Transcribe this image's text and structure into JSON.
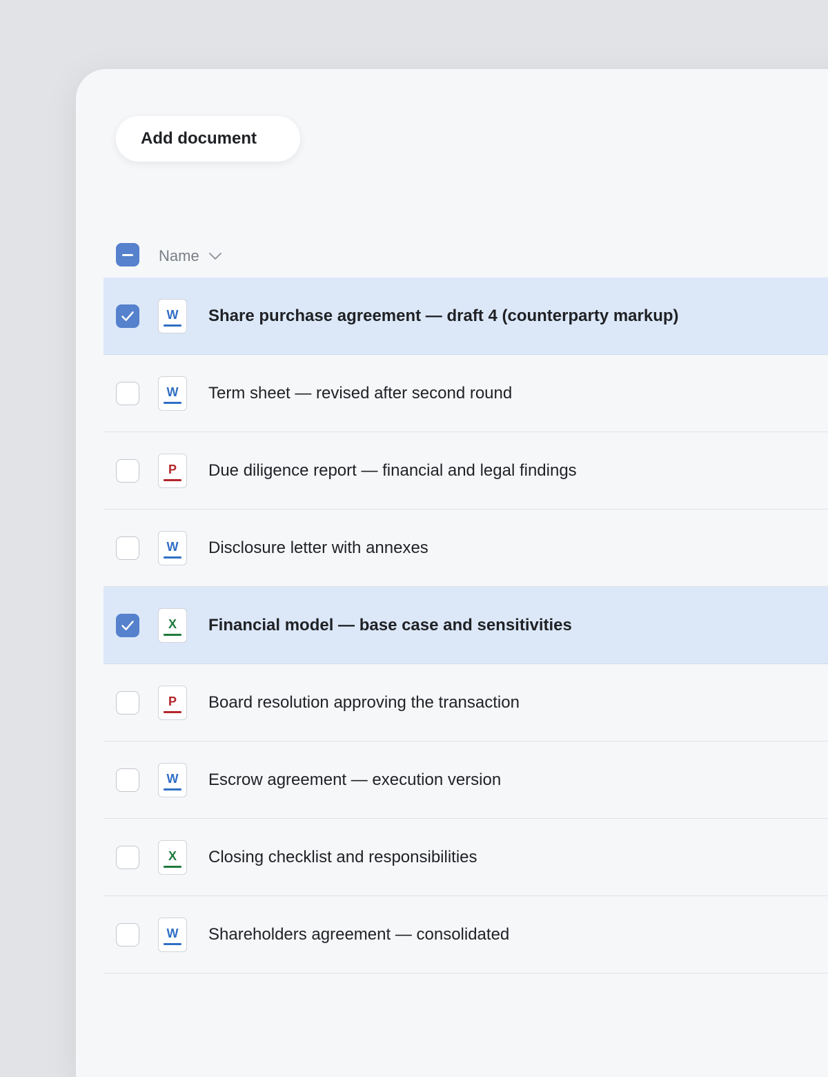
{
  "toolbar": {
    "add_label": "Add document"
  },
  "table": {
    "name_header": "Name",
    "select_all_state": "mixed",
    "rows": [
      {
        "name": "Share purchase agreement — draft 4 (counterparty markup)",
        "type": "word",
        "letter": "W",
        "selected": true
      },
      {
        "name": "Term sheet — revised after second round",
        "type": "word",
        "letter": "W",
        "selected": false
      },
      {
        "name": "Due diligence report — financial and legal findings",
        "type": "pdf",
        "letter": "P",
        "selected": false
      },
      {
        "name": "Disclosure letter with annexes",
        "type": "word",
        "letter": "W",
        "selected": false
      },
      {
        "name": "Financial model — base case and sensitivities",
        "type": "excel",
        "letter": "X",
        "selected": true
      },
      {
        "name": "Board resolution approving the transaction",
        "type": "pdf",
        "letter": "P",
        "selected": false
      },
      {
        "name": "Escrow agreement — execution version",
        "type": "word",
        "letter": "W",
        "selected": false
      },
      {
        "name": "Closing checklist and responsibilities",
        "type": "excel",
        "letter": "X",
        "selected": false
      },
      {
        "name": "Shareholders agreement — consolidated",
        "type": "word",
        "letter": "W",
        "selected": false
      }
    ]
  },
  "colors": {
    "accent": "#5581cd",
    "selected_row": "#dce8f8",
    "word": "#2f6fc4",
    "pdf": "#b3262b",
    "excel": "#1f7a3e"
  },
  "icons": {
    "select_all": "minus-icon",
    "checked": "checkmark-icon",
    "sort": "chevron-down-icon",
    "word": "word-file-icon",
    "pdf": "pdf-file-icon",
    "excel": "excel-file-icon"
  }
}
